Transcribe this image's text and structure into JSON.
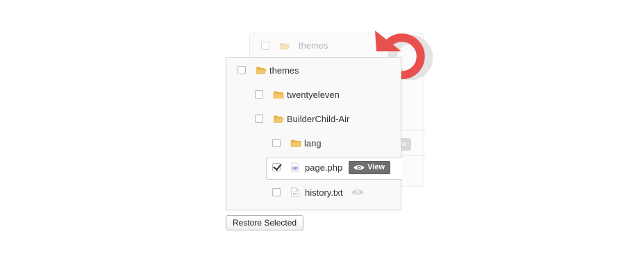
{
  "background_panel": {
    "folder_label": "themes",
    "view_peek_text": "w"
  },
  "tree": {
    "root": {
      "label": "themes",
      "checked": false
    },
    "twentyeleven": {
      "label": "twentyeleven",
      "checked": false
    },
    "builderchild": {
      "label": "BuilderChild-Air",
      "checked": false
    },
    "lang": {
      "label": "lang",
      "checked": false
    },
    "page_php": {
      "label": "page.php",
      "checked": true,
      "view_label": "View"
    },
    "history_txt": {
      "label": "history.txt",
      "checked": false
    }
  },
  "actions": {
    "restore_label": "Restore Selected"
  },
  "colors": {
    "undo_red": "#e8504d",
    "folder_yellow": "#f2c462",
    "view_button": "#6f6f6f"
  },
  "icons": {
    "undo": "undo-icon",
    "folder": "folder-icon",
    "php_file": "php-file-icon",
    "text_file": "text-file-icon",
    "eye": "eye-icon"
  }
}
